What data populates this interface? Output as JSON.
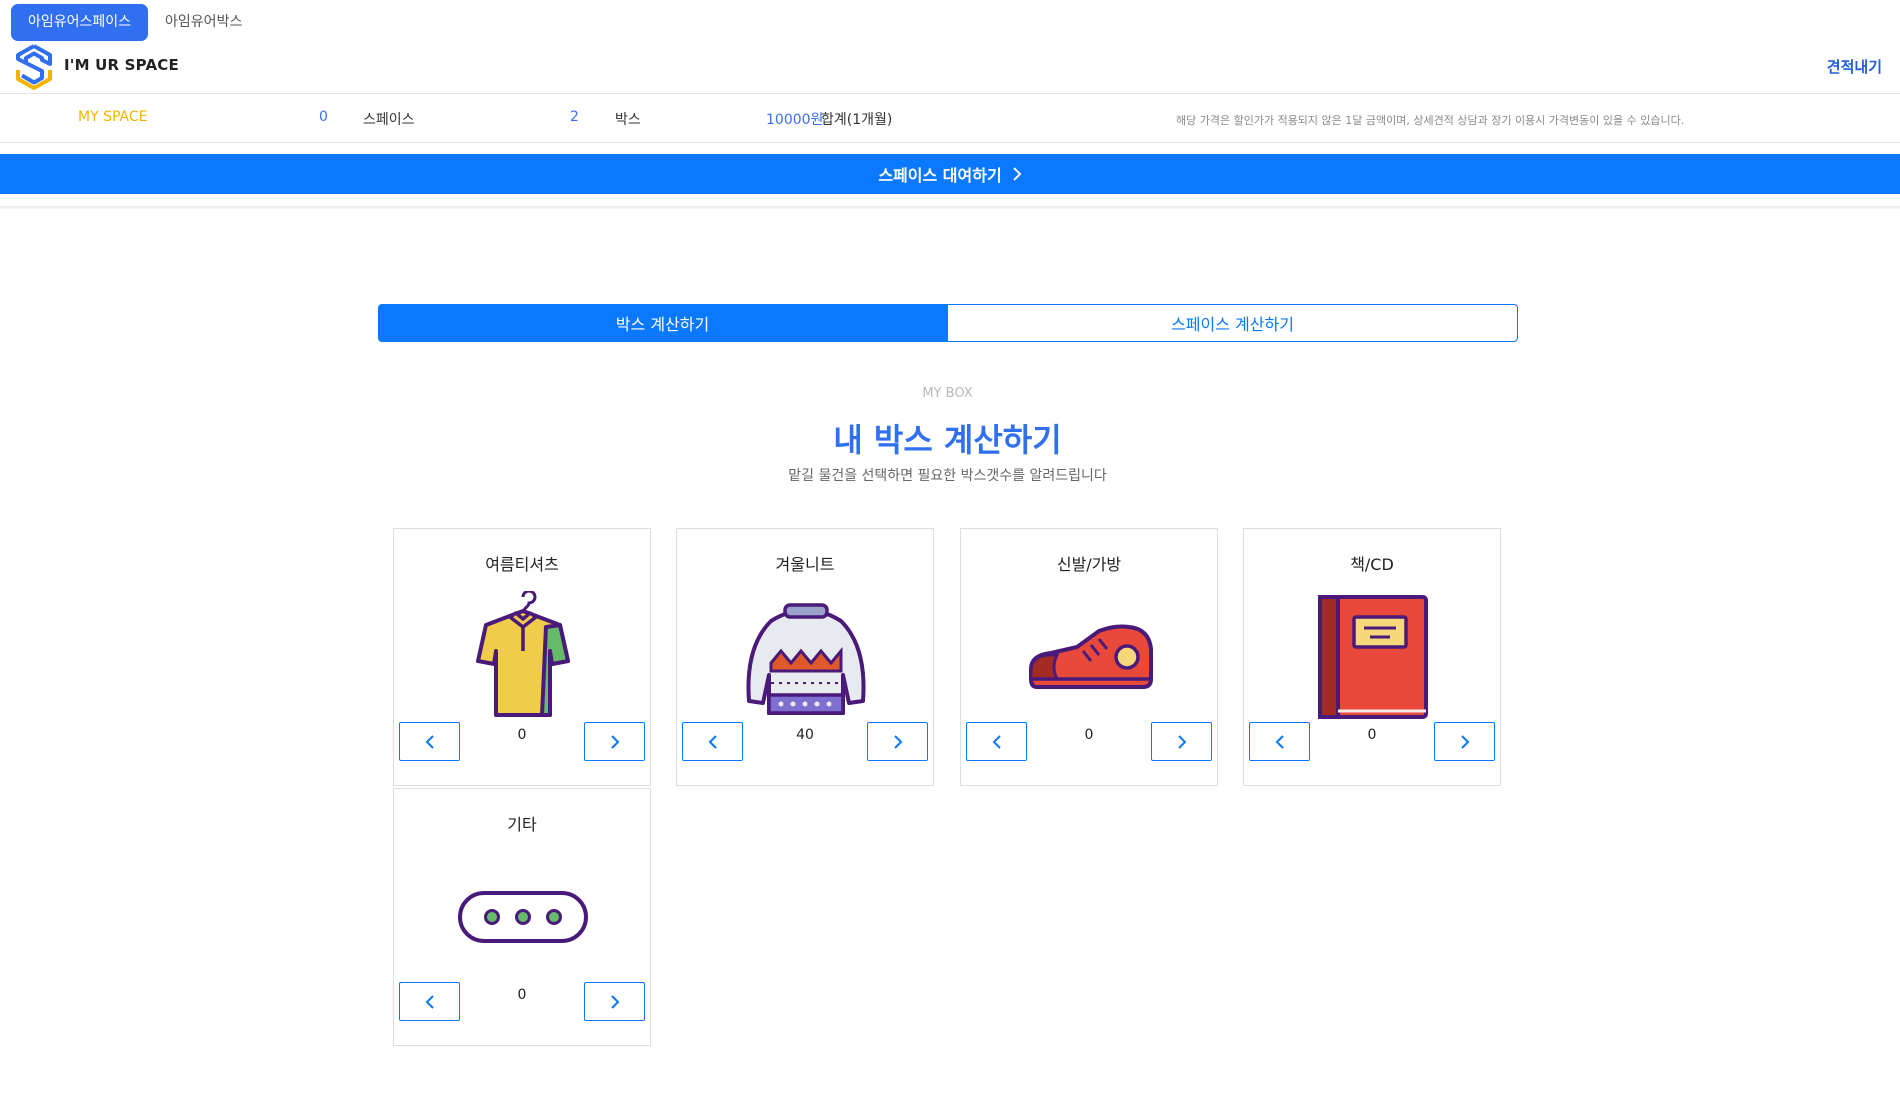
{
  "top_tabs": [
    {
      "label": "아임유어스페이스",
      "active": true
    },
    {
      "label": "아임유어박스",
      "active": false
    }
  ],
  "header": {
    "brand": "I'M UR SPACE",
    "quote_link": "견적내기"
  },
  "summary": {
    "my_space": "MY SPACE",
    "space_count": "0",
    "space_label": "스페이스",
    "box_count": "2",
    "box_label": "박스",
    "total_price": "10000원",
    "total_label": "합계(1개월)",
    "notice": "해당 가격은 할인가가 적용되지 않은 1달 금액이며, 상세견적 상담과 장기 이용시 가격변동이 있을 수 있습니다."
  },
  "rent_button": "스페이스 대여하기",
  "calc_tabs": [
    {
      "label": "박스 계산하기",
      "active": true
    },
    {
      "label": "스페이스 계산하기",
      "active": false
    }
  ],
  "section": {
    "eyebrow": "MY BOX",
    "title": "내 박스 계산하기",
    "subtitle": "맡길 물건을 선택하면 필요한 박스갯수를 알려드립니다"
  },
  "items": [
    {
      "name": "여름티셔츠",
      "count": "0",
      "icon": "tshirt-icon"
    },
    {
      "name": "겨울니트",
      "count": "40",
      "icon": "sweater-icon"
    },
    {
      "name": "신발/가방",
      "count": "0",
      "icon": "sneaker-icon"
    },
    {
      "name": "책/CD",
      "count": "0",
      "icon": "book-icon"
    },
    {
      "name": "기타",
      "count": "0",
      "icon": "more-icon"
    }
  ],
  "colors": {
    "primary": "#0a78ff",
    "accent_yellow": "#f0b400",
    "heading_blue": "#2f6ff0"
  }
}
